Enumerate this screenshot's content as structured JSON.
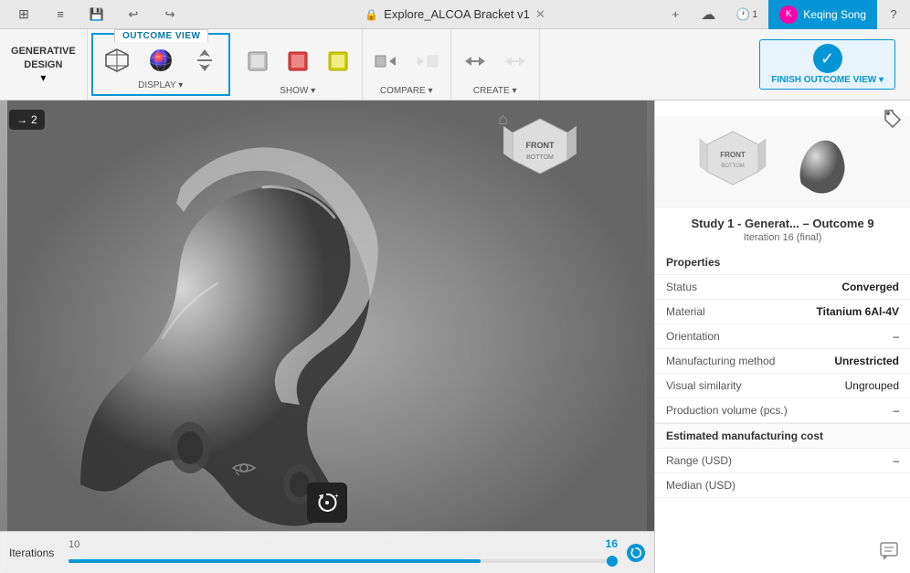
{
  "titlebar": {
    "app_grid_icon": "⊞",
    "save_icon": "💾",
    "undo_icon": "↩",
    "redo_icon": "↪",
    "title": "Explore_ALCOA Bracket v1",
    "close_icon": "✕",
    "plus_icon": "+",
    "cloud_icon": "☁",
    "clock_icon": "🕐",
    "clock_count": "1",
    "user_name": "Keqing Song",
    "help_icon": "?"
  },
  "toolbar": {
    "outcome_view_label": "OUTCOME VIEW",
    "generative_design_label": "GENERATIVE\nDESIGN",
    "generative_design_arrow": "▾",
    "display_label": "DISPLAY ▾",
    "show_label": "SHOW ▾",
    "compare_label": "COMPARE ▾",
    "create_label": "CREATE ▾",
    "finish_label": "FINISH OUTCOME VIEW ▾",
    "display_cube_icon": "cube",
    "display_color_icon": "color",
    "display_arrows_icon": "arrows"
  },
  "viewport": {
    "iter_badge_icon": "→",
    "iter_badge_num": "2",
    "home_icon": "⌂",
    "eye_icon": "👁",
    "reset_icon": "↺",
    "iterations_label": "Iterations",
    "iter_num_left": "10",
    "iter_num_right": "16",
    "iter_fill_pct": 75,
    "tag_icon": "🏷"
  },
  "panel": {
    "title": "Study 1 - Generat... – Outcome 9",
    "subtitle": "Iteration 16 (final)",
    "properties_label": "Properties",
    "rows": [
      {
        "label": "Status",
        "value": "Converged"
      },
      {
        "label": "Material",
        "value": "Titanium 6Al-4V"
      },
      {
        "label": "Orientation",
        "value": "–"
      },
      {
        "label": "Manufacturing method",
        "value": "Unrestricted"
      },
      {
        "label": "Visual similarity",
        "value": "Ungrouped"
      },
      {
        "label": "Production volume (pcs.)",
        "value": "–"
      }
    ],
    "section_label": "Estimated manufacturing cost",
    "cost_rows": [
      {
        "label": "Range (USD)",
        "value": "–"
      },
      {
        "label": "Median (USD)",
        "value": ""
      }
    ],
    "chat_icon": "💬"
  }
}
